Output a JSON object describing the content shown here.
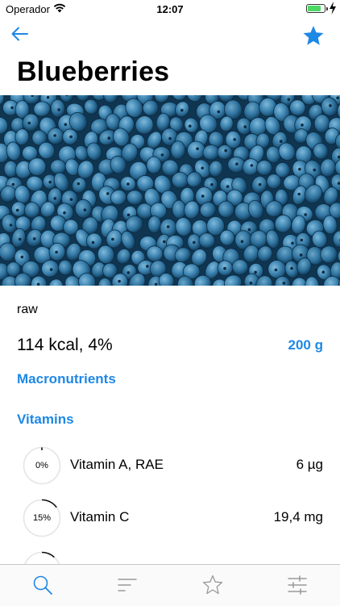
{
  "status_bar": {
    "carrier": "Operador",
    "time": "12:07"
  },
  "food": {
    "title": "Blueberries",
    "variant": "raw",
    "energy": "114 kcal, 4%",
    "amount": "200 g"
  },
  "sections": {
    "macronutrients": "Macronutrients",
    "vitamins": "Vitamins"
  },
  "vitamins": [
    {
      "name": "Vitamin A, RAE",
      "percent_label": "0%",
      "percent": 0,
      "value": "6 µg"
    },
    {
      "name": "Vitamin C",
      "percent_label": "15%",
      "percent": 15,
      "value": "19,4 mg"
    },
    {
      "percent": 12
    }
  ],
  "colors": {
    "accent": "#1e88e5",
    "ring_track": "#e5e5e5",
    "ring_fill": "#111111"
  },
  "tab_bar": {
    "tabs": [
      "search-icon",
      "list-sort-icon",
      "star-outline-icon",
      "sliders-icon"
    ],
    "active": 0
  }
}
